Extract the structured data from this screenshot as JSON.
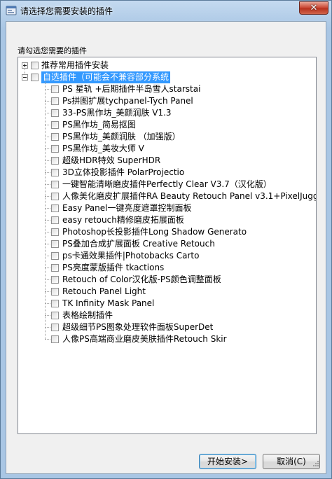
{
  "window": {
    "title": "请选择您需要安装的插件",
    "close_glyph": "✕"
  },
  "prompt": "请勾选您需要的插件",
  "tree": {
    "groups": [
      {
        "label": "推荐常用插件安装",
        "expanded": false,
        "checked": false
      },
      {
        "label": "自选插件（可能会不兼容部分系统",
        "expanded": true,
        "checked": false,
        "selected": true
      }
    ],
    "items": [
      "PS 星轨 +后期插件半岛雪人starstai",
      "Ps拼图扩展tychpanel-Tych Panel",
      "33-PS黑作坊_美颜润肤 V1.3",
      "PS黑作坊_简易抠图",
      "PS黑作坊_美颜润肤 （加强版）",
      "PS黑作坊_美妆大师 V",
      "超级HDR特效 SuperHDR",
      "3D立体投影插件 PolarProjectio",
      "一键智能清晰磨皮插件Perfectly Clear V3.7（汉化版）",
      "人像美化磨皮扩展插件RA Beauty Retouch Panel v3.1+PixelJugg",
      "Easy Panel一键亮度遮罩控制面板",
      "easy retouch精修磨皮拓展面板",
      "Photoshop长投影插件Long Shadow Generato",
      "PS叠加合成扩展面板 Creative Retouch",
      "ps卡通效果插件|Photobacks Carto",
      "PS亮度蒙版插件 tkactions",
      "Retouch of Color汉化版-PS颜色调整面板",
      "Retouch Panel Light",
      "TK Infinity Mask Panel",
      "表格绘制插件",
      "超级细节PS图象处理软件面板SuperDet",
      "人像PS高端商业磨皮美肤插件Retouch Skir"
    ]
  },
  "buttons": {
    "install": "开始安装>",
    "cancel": "取消(C)"
  },
  "colors": {
    "selection": "#3399ff",
    "close_button": "#c8432f"
  }
}
